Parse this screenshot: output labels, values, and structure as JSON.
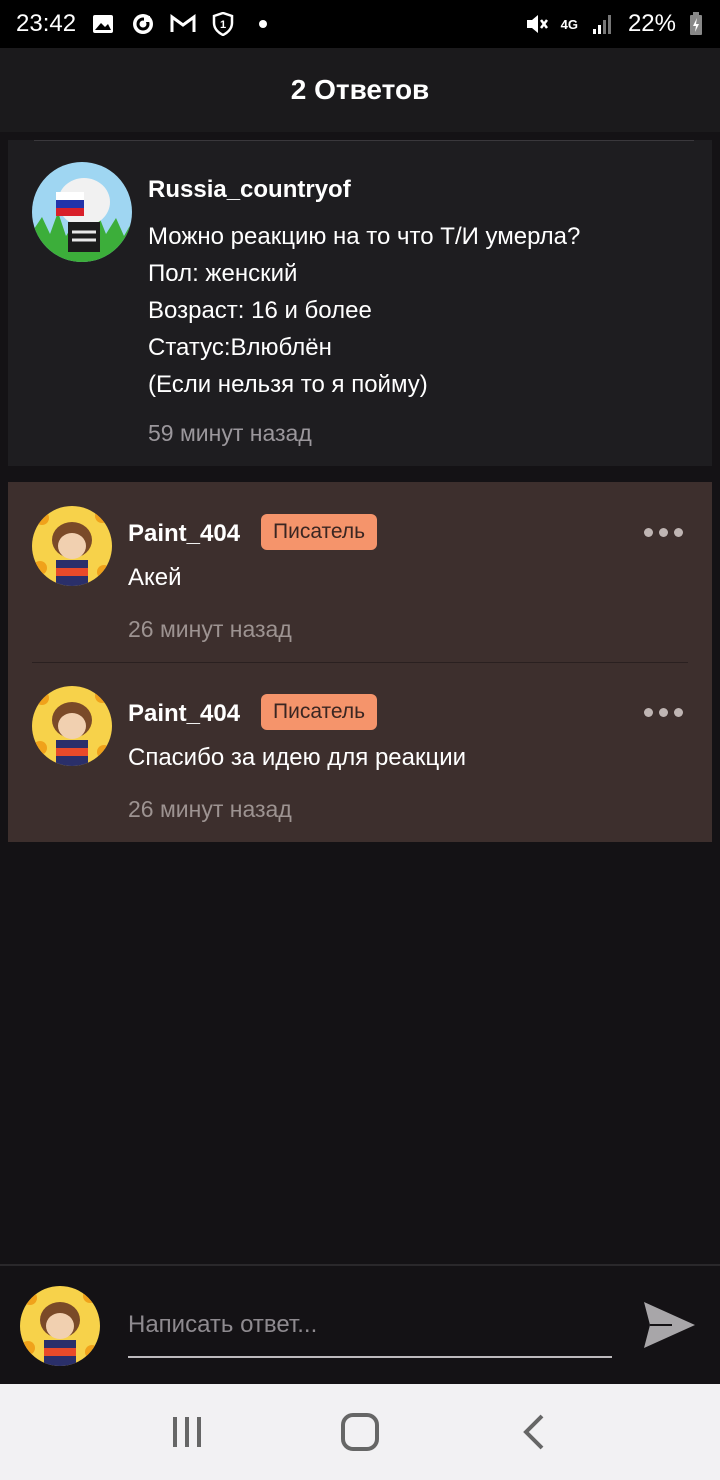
{
  "status_bar": {
    "time": "23:42",
    "battery": "22%",
    "network": "4G",
    "icons": [
      "image-icon",
      "sync-icon",
      "gmail-icon",
      "shield-icon",
      "dot-icon",
      "mute-icon",
      "signal-icon",
      "battery-icon"
    ]
  },
  "header": {
    "title": "2 Ответов"
  },
  "post": {
    "author": "Russia_countryof",
    "lines": [
      "Можно реакцию на то что Т/И умерла?",
      "Пол: женский",
      "Возраст: 16 и более",
      "Статус:Влюблён",
      "(Если нельзя то я пойму)"
    ],
    "time": "59 минут назад"
  },
  "replies": [
    {
      "author": "Paint_404",
      "badge": "Писатель",
      "text": "Акей",
      "time": "26 минут назад"
    },
    {
      "author": "Paint_404",
      "badge": "Писатель",
      "text": "Спасибо за идею для реакции",
      "time": "26 минут назад"
    }
  ],
  "compose": {
    "placeholder": "Написать ответ..."
  },
  "colors": {
    "background": "#141215",
    "reply_bg": "#3d2f2d",
    "badge_bg": "#f5946b",
    "post_bg": "#1e1d20"
  }
}
